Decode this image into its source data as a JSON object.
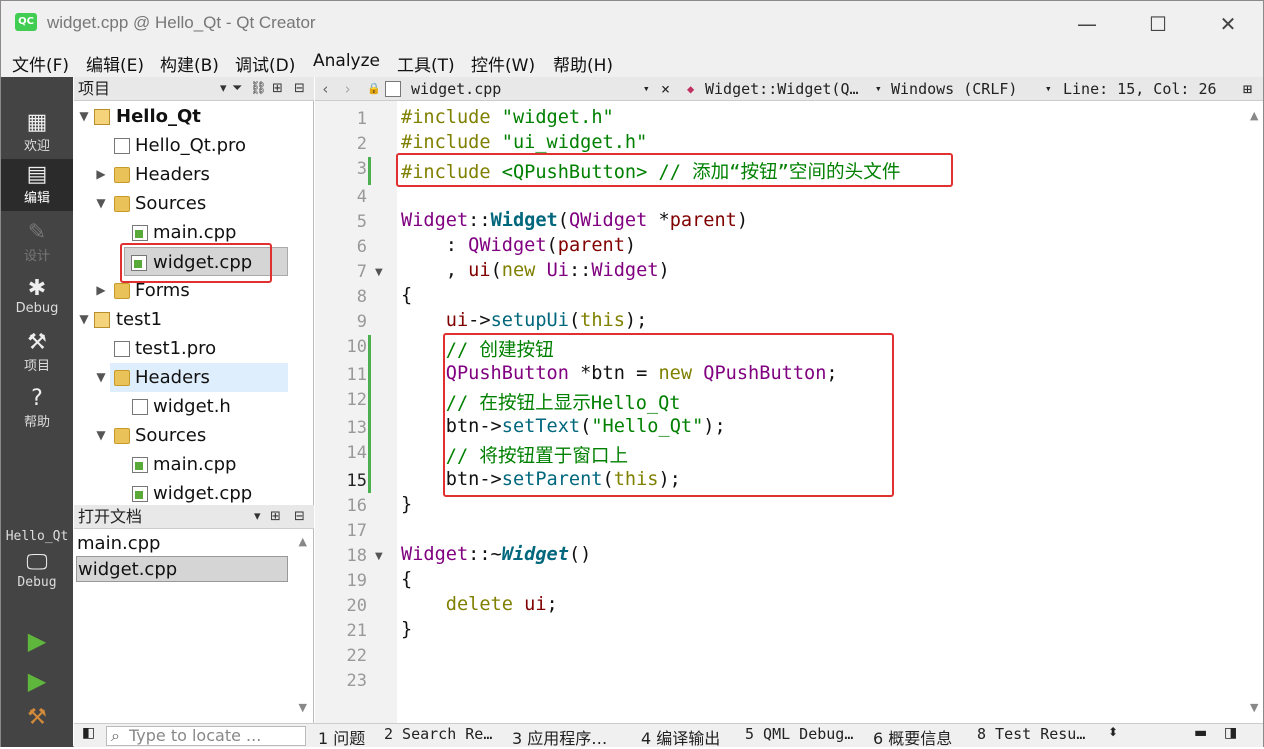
{
  "window": {
    "logo_text": "QC",
    "title": "widget.cpp @ Hello_Qt - Qt Creator",
    "minimize": "—",
    "maximize": "☐",
    "close": "✕"
  },
  "menu": [
    "文件(F)",
    "编辑(E)",
    "构建(B)",
    "调试(D)",
    "Analyze",
    "工具(T)",
    "控件(W)",
    "帮助(H)"
  ],
  "modes": [
    {
      "label": "欢迎",
      "icon": "grid-icon"
    },
    {
      "label": "编辑",
      "icon": "edit-icon"
    },
    {
      "label": "设计",
      "icon": "pencil-icon"
    },
    {
      "label": "Debug",
      "icon": "bug-icon"
    },
    {
      "label": "项目",
      "icon": "wrench-icon"
    },
    {
      "label": "帮助",
      "icon": "help-icon"
    }
  ],
  "kit": {
    "project": "Hello_Qt",
    "config": "Debug"
  },
  "projects_panel": {
    "title": "项目",
    "tree": [
      {
        "label": "Hello_Qt",
        "bold": true
      },
      {
        "label": "Hello_Qt.pro"
      },
      {
        "label": "Headers"
      },
      {
        "label": "Sources"
      },
      {
        "label": "main.cpp"
      },
      {
        "label": "widget.cpp"
      },
      {
        "label": "Forms"
      },
      {
        "label": "test1"
      },
      {
        "label": "test1.pro"
      },
      {
        "label": "Headers"
      },
      {
        "label": "widget.h"
      },
      {
        "label": "Sources"
      },
      {
        "label": "main.cpp"
      },
      {
        "label": "widget.cpp"
      }
    ]
  },
  "open_docs": {
    "title": "打开文档",
    "files": [
      "main.cpp",
      "widget.cpp"
    ]
  },
  "editor_toolbar": {
    "file": "widget.cpp",
    "symbol": "Widget::Widget(Q…",
    "line_ending": "Windows (CRLF)",
    "position": "Line: 15, Col: 26"
  },
  "code": {
    "line_numbers": [
      "1",
      "2",
      "3",
      "4",
      "5",
      "6",
      "7",
      "8",
      "9",
      "10",
      "11",
      "12",
      "13",
      "14",
      "15",
      "16",
      "17",
      "18",
      "19",
      "20",
      "21",
      "22",
      "23"
    ],
    "current_line": 15
  },
  "statusbar": {
    "locator_placeholder": "Type to locate ...",
    "tabs": [
      "1 问题",
      "2 Search Re…",
      "3 应用程序…",
      "4 编译输出",
      "5 QML Debug…",
      "6 概要信息",
      "8 Test Resu…"
    ]
  }
}
